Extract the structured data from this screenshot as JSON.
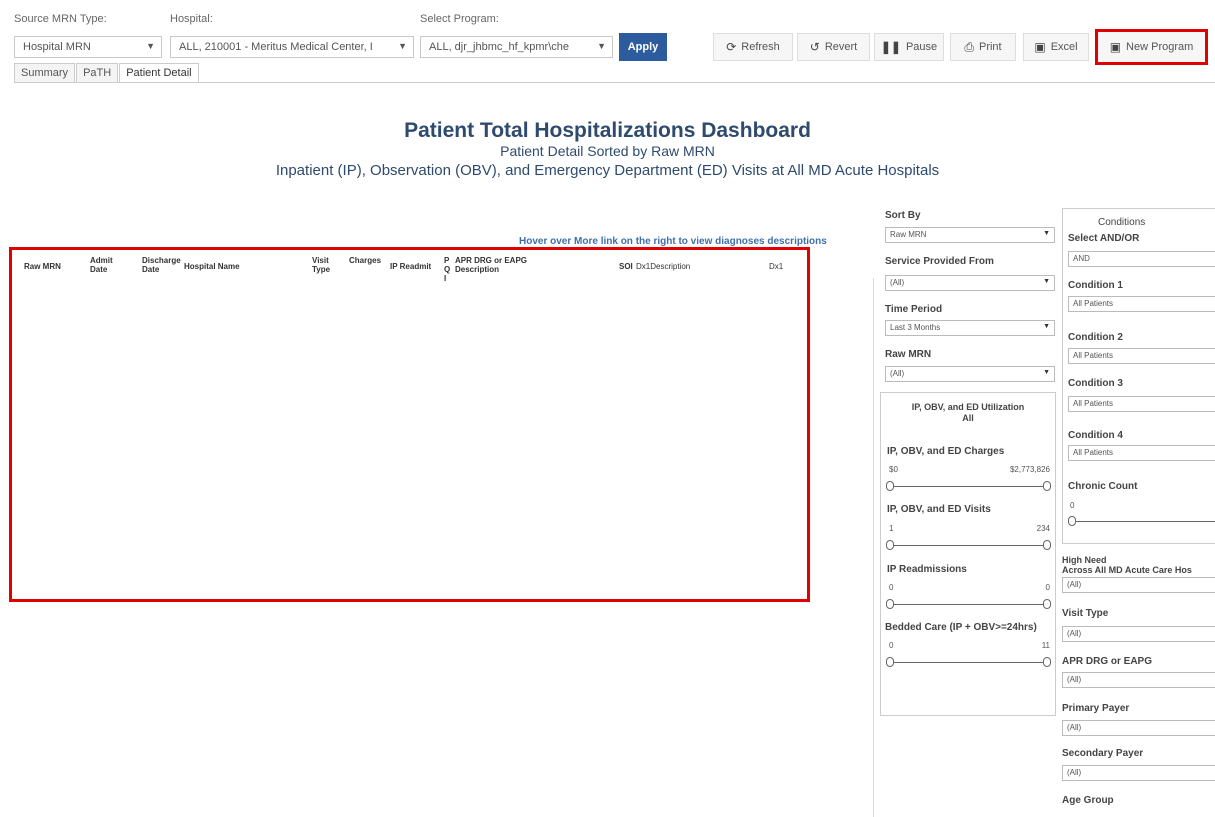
{
  "toolbar": {
    "source_label": "Source MRN Type:",
    "source_value": "Hospital MRN",
    "hospital_label": "Hospital:",
    "hospital_value": "ALL, 210001 - Meritus Medical Center, I",
    "program_label": "Select Program:",
    "program_value": "ALL, djr_jhbmc_hf_kpmr\\che",
    "apply": "Apply",
    "refresh": "Refresh",
    "revert": "Revert",
    "pause": "Pause",
    "print": "Print",
    "excel": "Excel",
    "new_program": "New Program"
  },
  "tabs": [
    "Summary",
    "PaTH",
    "Patient Detail"
  ],
  "header": {
    "title": "Patient Total Hospitalizations Dashboard",
    "subtitle1": "Patient Detail Sorted by Raw MRN",
    "subtitle2": "Inpatient (IP), Observation (OBV), and Emergency Department (ED) Visits at All MD Acute Hospitals"
  },
  "hover_note": "Hover over More link on the right to view diagnoses descriptions",
  "columns": [
    "Raw MRN",
    "Admit Date",
    "Discharge Date",
    "Hospital Name",
    "Visit Type",
    "Charges",
    "IP Readmit",
    "PQI",
    "APR DRG or EAPG Description",
    "SOI",
    "Dx1Description",
    "Dx1"
  ],
  "filters": {
    "sort_by_label": "Sort By",
    "sort_by_value": "Raw MRN",
    "service_label": "Service Provided From",
    "service_value": "(All)",
    "time_label": "Time Period",
    "time_value": "Last 3 Months",
    "mrn_label": "Raw MRN",
    "mrn_value": "(All)"
  },
  "utilization": {
    "title1": "IP, OBV, and ED Utilization",
    "title2": "All",
    "charges_label": "IP, OBV, and ED Charges",
    "charges_min": "$0",
    "charges_max": "$2,773,826",
    "visits_label": "IP, OBV, and ED Visits",
    "visits_min": "1",
    "visits_max": "234",
    "readmit_label": "IP Readmissions",
    "readmit_min": "0",
    "readmit_max": "0",
    "bedded_label": "Bedded Care (IP + OBV>=24hrs)",
    "bedded_min": "0",
    "bedded_max": "11"
  },
  "conditions": {
    "title": "Conditions",
    "andor_label": "Select AND/OR",
    "andor_value": "AND",
    "c1_label": "Condition 1",
    "c1_value": "All Patients",
    "c2_label": "Condition 2",
    "c2_value": "All Patients",
    "c3_label": "Condition 3",
    "c3_value": "All Patients",
    "c4_label": "Condition 4",
    "c4_value": "All Patients",
    "chronic_label": "Chronic Count",
    "chronic_min": "0",
    "high_need_label1": "High Need",
    "high_need_label2": "Across All MD Acute Care Hos",
    "high_need_value": "(All)",
    "visit_type_label": "Visit Type",
    "visit_type_value": "(All)",
    "apr_label": "APR DRG or EAPG",
    "apr_value": "(All)",
    "primary_label": "Primary Payer",
    "primary_value": "(All)",
    "secondary_label": "Secondary Payer",
    "secondary_value": "(All)",
    "age_label": "Age Group"
  }
}
